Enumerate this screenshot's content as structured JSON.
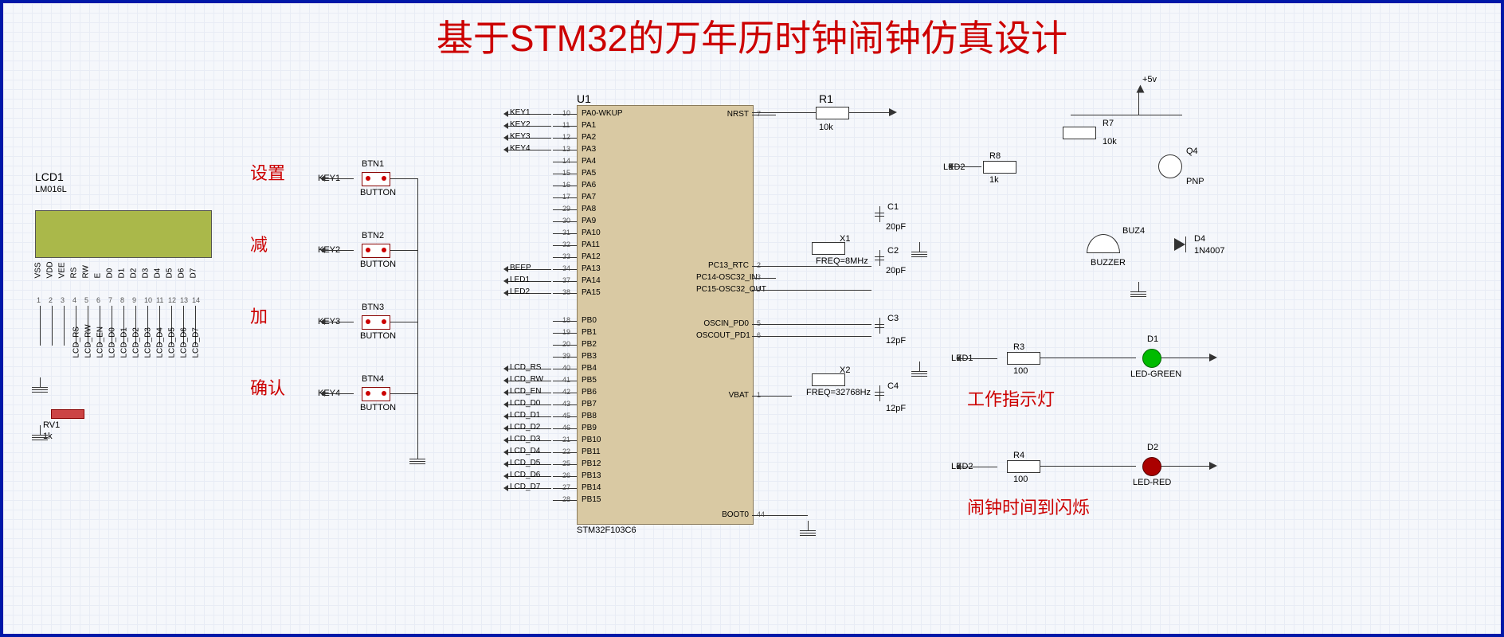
{
  "title": "基于STM32的万年历时钟闹钟仿真设计",
  "lcd": {
    "ref": "LCD1",
    "part": "LM016L",
    "pins_top": [
      "VSS",
      "VDD",
      "VEE",
      "RS",
      "RW",
      "E",
      "D0",
      "D1",
      "D2",
      "D3",
      "D4",
      "D5",
      "D6",
      "D7"
    ],
    "pin_nums": [
      "1",
      "2",
      "3",
      "4",
      "5",
      "6",
      "7",
      "8",
      "9",
      "10",
      "11",
      "12",
      "13",
      "14"
    ],
    "nets": [
      "LCD_RS",
      "LCD_RW",
      "LCD_EN",
      "LCD_D0",
      "LCD_D1",
      "LCD_D2",
      "LCD_D3",
      "LCD_D4",
      "LCD_D5",
      "LCD_D6",
      "LCD_D7"
    ]
  },
  "rv1": {
    "ref": "RV1",
    "val": "1k"
  },
  "buttons": [
    {
      "ref": "BTN1",
      "part": "BUTTON",
      "net": "KEY1",
      "label": "设置"
    },
    {
      "ref": "BTN2",
      "part": "BUTTON",
      "net": "KEY2",
      "label": "减"
    },
    {
      "ref": "BTN3",
      "part": "BUTTON",
      "net": "KEY3",
      "label": "加"
    },
    {
      "ref": "BTN4",
      "part": "BUTTON",
      "net": "KEY4",
      "label": "确认"
    }
  ],
  "mcu": {
    "ref": "U1",
    "part": "STM32F103C6",
    "left_pins": [
      {
        "n": "10",
        "name": "PA0-WKUP"
      },
      {
        "n": "11",
        "name": "PA1"
      },
      {
        "n": "12",
        "name": "PA2"
      },
      {
        "n": "13",
        "name": "PA3"
      },
      {
        "n": "14",
        "name": "PA4"
      },
      {
        "n": "15",
        "name": "PA5"
      },
      {
        "n": "16",
        "name": "PA6"
      },
      {
        "n": "17",
        "name": "PA7"
      },
      {
        "n": "29",
        "name": "PA8"
      },
      {
        "n": "30",
        "name": "PA9"
      },
      {
        "n": "31",
        "name": "PA10"
      },
      {
        "n": "32",
        "name": "PA11"
      },
      {
        "n": "33",
        "name": "PA12"
      },
      {
        "n": "34",
        "name": "PA13"
      },
      {
        "n": "37",
        "name": "PA14"
      },
      {
        "n": "38",
        "name": "PA15"
      },
      {
        "n": "18",
        "name": "PB0"
      },
      {
        "n": "19",
        "name": "PB1"
      },
      {
        "n": "20",
        "name": "PB2"
      },
      {
        "n": "39",
        "name": "PB3"
      },
      {
        "n": "40",
        "name": "PB4"
      },
      {
        "n": "41",
        "name": "PB5"
      },
      {
        "n": "42",
        "name": "PB6"
      },
      {
        "n": "43",
        "name": "PB7"
      },
      {
        "n": "45",
        "name": "PB8"
      },
      {
        "n": "46",
        "name": "PB9"
      },
      {
        "n": "21",
        "name": "PB10"
      },
      {
        "n": "22",
        "name": "PB11"
      },
      {
        "n": "25",
        "name": "PB12"
      },
      {
        "n": "26",
        "name": "PB13"
      },
      {
        "n": "27",
        "name": "PB14"
      },
      {
        "n": "28",
        "name": "PB15"
      }
    ],
    "right_pins": [
      {
        "n": "7",
        "name": "NRST"
      },
      {
        "n": "2",
        "name": "PC13_RTC"
      },
      {
        "n": "3",
        "name": "PC14-OSC32_IN"
      },
      {
        "n": "4",
        "name": "PC15-OSC32_OUT"
      },
      {
        "n": "5",
        "name": "OSCIN_PD0"
      },
      {
        "n": "6",
        "name": "OSCOUT_PD1"
      },
      {
        "n": "1",
        "name": "VBAT"
      },
      {
        "n": "44",
        "name": "BOOT0"
      }
    ],
    "left_nets": [
      "KEY1",
      "KEY2",
      "KEY3",
      "KEY4",
      "BEEP",
      "LED1",
      "LED2",
      "LCD_RS",
      "LCD_RW",
      "LCD_EN",
      "LCD_D0",
      "LCD_D1",
      "LCD_D2",
      "LCD_D3",
      "LCD_D4",
      "LCD_D5",
      "LCD_D6",
      "LCD_D7"
    ]
  },
  "r1": {
    "ref": "R1",
    "val": "10k"
  },
  "crystals": [
    {
      "ref": "X1",
      "val": "FREQ=8MHz"
    },
    {
      "ref": "X2",
      "val": "FREQ=32768Hz"
    }
  ],
  "caps": [
    {
      "ref": "C1",
      "val": "20pF"
    },
    {
      "ref": "C2",
      "val": "20pF"
    },
    {
      "ref": "C3",
      "val": "12pF"
    },
    {
      "ref": "C4",
      "val": "12pF"
    }
  ],
  "buzzer_section": {
    "vcc": "+5v",
    "r7": {
      "ref": "R7",
      "val": "10k"
    },
    "r8": {
      "ref": "R8",
      "val": "1k"
    },
    "q4": {
      "ref": "Q4",
      "val": "PNP"
    },
    "buz": {
      "ref": "BUZ4",
      "val": "BUZZER"
    },
    "d4": {
      "ref": "D4",
      "val": "1N4007"
    },
    "net": "LED2"
  },
  "leds": [
    {
      "ref": "D1",
      "val": "LED-GREEN",
      "res": {
        "ref": "R3",
        "val": "100"
      },
      "net": "LED1",
      "caption": "工作指示灯"
    },
    {
      "ref": "D2",
      "val": "LED-RED",
      "res": {
        "ref": "R4",
        "val": "100"
      },
      "net": "LED2",
      "caption": "闹钟时间到闪烁"
    }
  ]
}
